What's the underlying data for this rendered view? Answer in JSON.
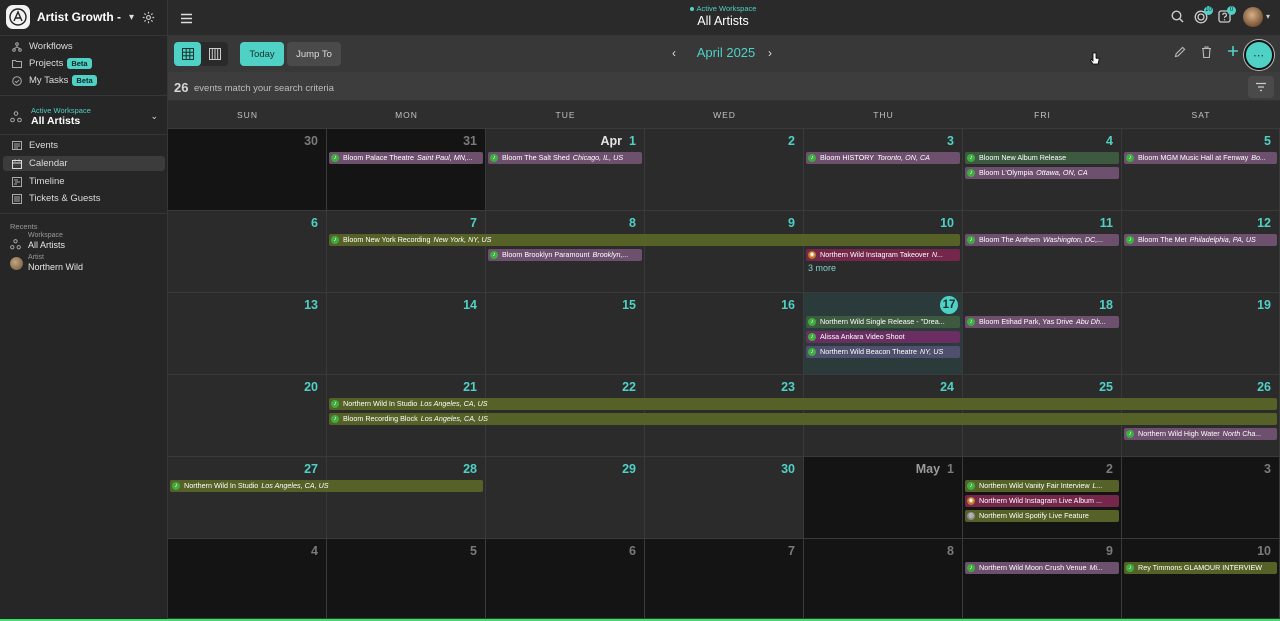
{
  "sidebar": {
    "workspace_name": "Artist Growth - ...",
    "nav_top": [
      {
        "label": "Workflows",
        "icon": "workflow-icon",
        "badge": ""
      },
      {
        "label": "Projects",
        "icon": "folder-icon",
        "badge": "Beta"
      },
      {
        "label": "My Tasks",
        "icon": "check-circle-icon",
        "badge": "Beta"
      }
    ],
    "active_workspace": {
      "label": "Active Workspace",
      "name": "All Artists"
    },
    "nav_main": [
      {
        "label": "Events",
        "icon": "list-icon"
      },
      {
        "label": "Calendar",
        "icon": "calendar-icon",
        "active": true
      },
      {
        "label": "Timeline",
        "icon": "timeline-icon"
      },
      {
        "label": "Tickets & Guests",
        "icon": "ticket-icon"
      }
    ],
    "recents_label": "Recents",
    "recents": [
      {
        "type": "Workspace",
        "name": "All Artists"
      },
      {
        "type": "Artist",
        "name": "Northern Wild"
      }
    ]
  },
  "header": {
    "active_label": "Active Workspace",
    "title": "All Artists",
    "badges": {
      "activity": "10",
      "tasks": "0"
    }
  },
  "toolbar": {
    "today": "Today",
    "jump": "Jump To",
    "month": "April 2025"
  },
  "criteria": {
    "count": "26",
    "text": "events match your search criteria"
  },
  "days_of_week": [
    "SUN",
    "MON",
    "TUE",
    "WED",
    "THU",
    "FRI",
    "SAT"
  ],
  "colors": {
    "accent": "#4fd1c5",
    "gig": "#6d4f6e",
    "studio": "#566128",
    "release": "#3d5a41",
    "promo": "#74274a",
    "video": "#6b2e63"
  },
  "weeks": [
    {
      "days": [
        {
          "num": "30",
          "out": true
        },
        {
          "num": "31",
          "out": true
        },
        {
          "num": "1",
          "month": "Apr"
        },
        {
          "num": "2"
        },
        {
          "num": "3"
        },
        {
          "num": "4"
        },
        {
          "num": "5"
        }
      ]
    },
    {
      "days": [
        {
          "num": "6"
        },
        {
          "num": "7"
        },
        {
          "num": "8"
        },
        {
          "num": "9"
        },
        {
          "num": "10"
        },
        {
          "num": "11"
        },
        {
          "num": "12"
        }
      ]
    },
    {
      "days": [
        {
          "num": "13"
        },
        {
          "num": "14"
        },
        {
          "num": "15"
        },
        {
          "num": "16"
        },
        {
          "num": "17",
          "today": true
        },
        {
          "num": "18"
        },
        {
          "num": "19"
        }
      ]
    },
    {
      "days": [
        {
          "num": "20"
        },
        {
          "num": "21"
        },
        {
          "num": "22"
        },
        {
          "num": "23"
        },
        {
          "num": "24"
        },
        {
          "num": "25"
        },
        {
          "num": "26"
        }
      ]
    },
    {
      "days": [
        {
          "num": "27"
        },
        {
          "num": "28"
        },
        {
          "num": "29"
        },
        {
          "num": "30"
        },
        {
          "num": "1",
          "month": "May",
          "out": true
        },
        {
          "num": "2",
          "out": true
        },
        {
          "num": "3",
          "out": true
        }
      ]
    },
    {
      "days": [
        {
          "num": "4",
          "out": true
        },
        {
          "num": "5",
          "out": true
        },
        {
          "num": "6",
          "out": true
        },
        {
          "num": "7",
          "out": true
        },
        {
          "num": "8",
          "out": true
        },
        {
          "num": "9",
          "out": true
        },
        {
          "num": "10",
          "out": true
        }
      ]
    }
  ],
  "events": [
    {
      "week": 0,
      "start": 1,
      "span": 1,
      "slot": 0,
      "style": "purple",
      "icon": "green",
      "text": "Bloom  Palace Theatre",
      "loc": "Saint Paul, MN,..."
    },
    {
      "week": 0,
      "start": 2,
      "span": 1,
      "slot": 0,
      "style": "purple",
      "icon": "green",
      "text": "Bloom  The Salt Shed",
      "loc": "Chicago, IL, US"
    },
    {
      "week": 0,
      "start": 4,
      "span": 1,
      "slot": 0,
      "style": "purple",
      "icon": "green",
      "text": "Bloom  HISTORY",
      "loc": "Toronto, ON, CA"
    },
    {
      "week": 0,
      "start": 5,
      "span": 1,
      "slot": 0,
      "style": "green",
      "icon": "green",
      "text": "Bloom  New Album Release",
      "loc": ""
    },
    {
      "week": 0,
      "start": 5,
      "span": 1,
      "slot": 1,
      "style": "purple",
      "icon": "green",
      "text": "Bloom  L'Olympia",
      "loc": "Ottawa, ON, CA"
    },
    {
      "week": 0,
      "start": 6,
      "span": 1,
      "slot": 0,
      "style": "purple",
      "icon": "green",
      "text": "Bloom  MGM Music Hall at Fenway",
      "loc": "Bo..."
    },
    {
      "week": 1,
      "start": 1,
      "span": 4,
      "slot": 0,
      "style": "olive",
      "icon": "green",
      "text": "Bloom  New York Recording",
      "loc": "New York, NY, US"
    },
    {
      "week": 1,
      "start": 5,
      "span": 1,
      "slot": 0,
      "style": "purple",
      "icon": "green",
      "text": "Bloom  The Anthem",
      "loc": "Washington, DC,..."
    },
    {
      "week": 1,
      "start": 6,
      "span": 1,
      "slot": 0,
      "style": "purple",
      "icon": "green",
      "text": "Bloom  The Met",
      "loc": "Philadelphia, PA, US"
    },
    {
      "week": 1,
      "start": 2,
      "span": 1,
      "slot": 1,
      "style": "purple",
      "icon": "green",
      "text": "Bloom  Brooklyn Paramount",
      "loc": "Brooklyn,..."
    },
    {
      "week": 1,
      "start": 4,
      "span": 1,
      "slot": 1,
      "style": "maroon",
      "icon": "orange",
      "text": "Northern Wild  Instagram Takeover",
      "loc": "N..."
    },
    {
      "week": 2,
      "start": 4,
      "span": 1,
      "slot": 0,
      "style": "green",
      "icon": "green",
      "text": "Northern Wild  Single Release - \"Drea...",
      "loc": ""
    },
    {
      "week": 2,
      "start": 4,
      "span": 1,
      "slot": 1,
      "style": "magenta",
      "icon": "green",
      "text": "Alissa Ankara  Video Shoot",
      "loc": ""
    },
    {
      "week": 2,
      "start": 4,
      "span": 1,
      "slot": 2,
      "style": "slate",
      "icon": "green",
      "text": "Northern Wild  Beacon Theatre",
      "loc": "NY, US"
    },
    {
      "week": 2,
      "start": 5,
      "span": 1,
      "slot": 0,
      "style": "purple",
      "icon": "green",
      "text": "Bloom  Etihad Park, Yas Drive",
      "loc": "Abu Dh..."
    },
    {
      "week": 3,
      "start": 1,
      "span": 6,
      "slot": 0,
      "style": "olive",
      "icon": "green",
      "text": "Northern Wild  In Studio",
      "loc": "Los Angeles, CA, US"
    },
    {
      "week": 3,
      "start": 1,
      "span": 6,
      "slot": 1,
      "style": "olive",
      "icon": "green",
      "text": "Bloom  Recording Block",
      "loc": "Los Angeles, CA, US"
    },
    {
      "week": 3,
      "start": 6,
      "span": 1,
      "slot": 2,
      "style": "purple",
      "icon": "green",
      "text": "Northern Wild  High Water",
      "loc": "North Cha..."
    },
    {
      "week": 4,
      "start": 0,
      "span": 2,
      "slot": 0,
      "style": "olive",
      "icon": "green",
      "text": "Northern Wild  In Studio",
      "loc": "Los Angeles, CA, US"
    },
    {
      "week": 4,
      "start": 5,
      "span": 1,
      "slot": 0,
      "style": "olive",
      "icon": "green",
      "text": "Northern Wild  Vanity Fair Interview",
      "loc": "L..."
    },
    {
      "week": 4,
      "start": 5,
      "span": 1,
      "slot": 1,
      "style": "maroon",
      "icon": "orange",
      "text": "Northern Wild  Instagram Live Album ...",
      "loc": ""
    },
    {
      "week": 4,
      "start": 5,
      "span": 1,
      "slot": 2,
      "style": "olive",
      "icon": "grey",
      "text": "Northern Wild  Spotify Live Feature",
      "loc": ""
    },
    {
      "week": 5,
      "start": 5,
      "span": 1,
      "slot": 0,
      "style": "purple",
      "icon": "green",
      "text": "Northern Wild  Moon Crush Venue",
      "loc": "Mi..."
    },
    {
      "week": 5,
      "start": 6,
      "span": 1,
      "slot": 0,
      "style": "olive",
      "icon": "green",
      "text": "Rey Timmons  GLAMOUR INTERVIEW",
      "loc": ""
    }
  ],
  "more_links": [
    {
      "week": 1,
      "day": 4,
      "slot": 2,
      "text": "3 more"
    }
  ]
}
